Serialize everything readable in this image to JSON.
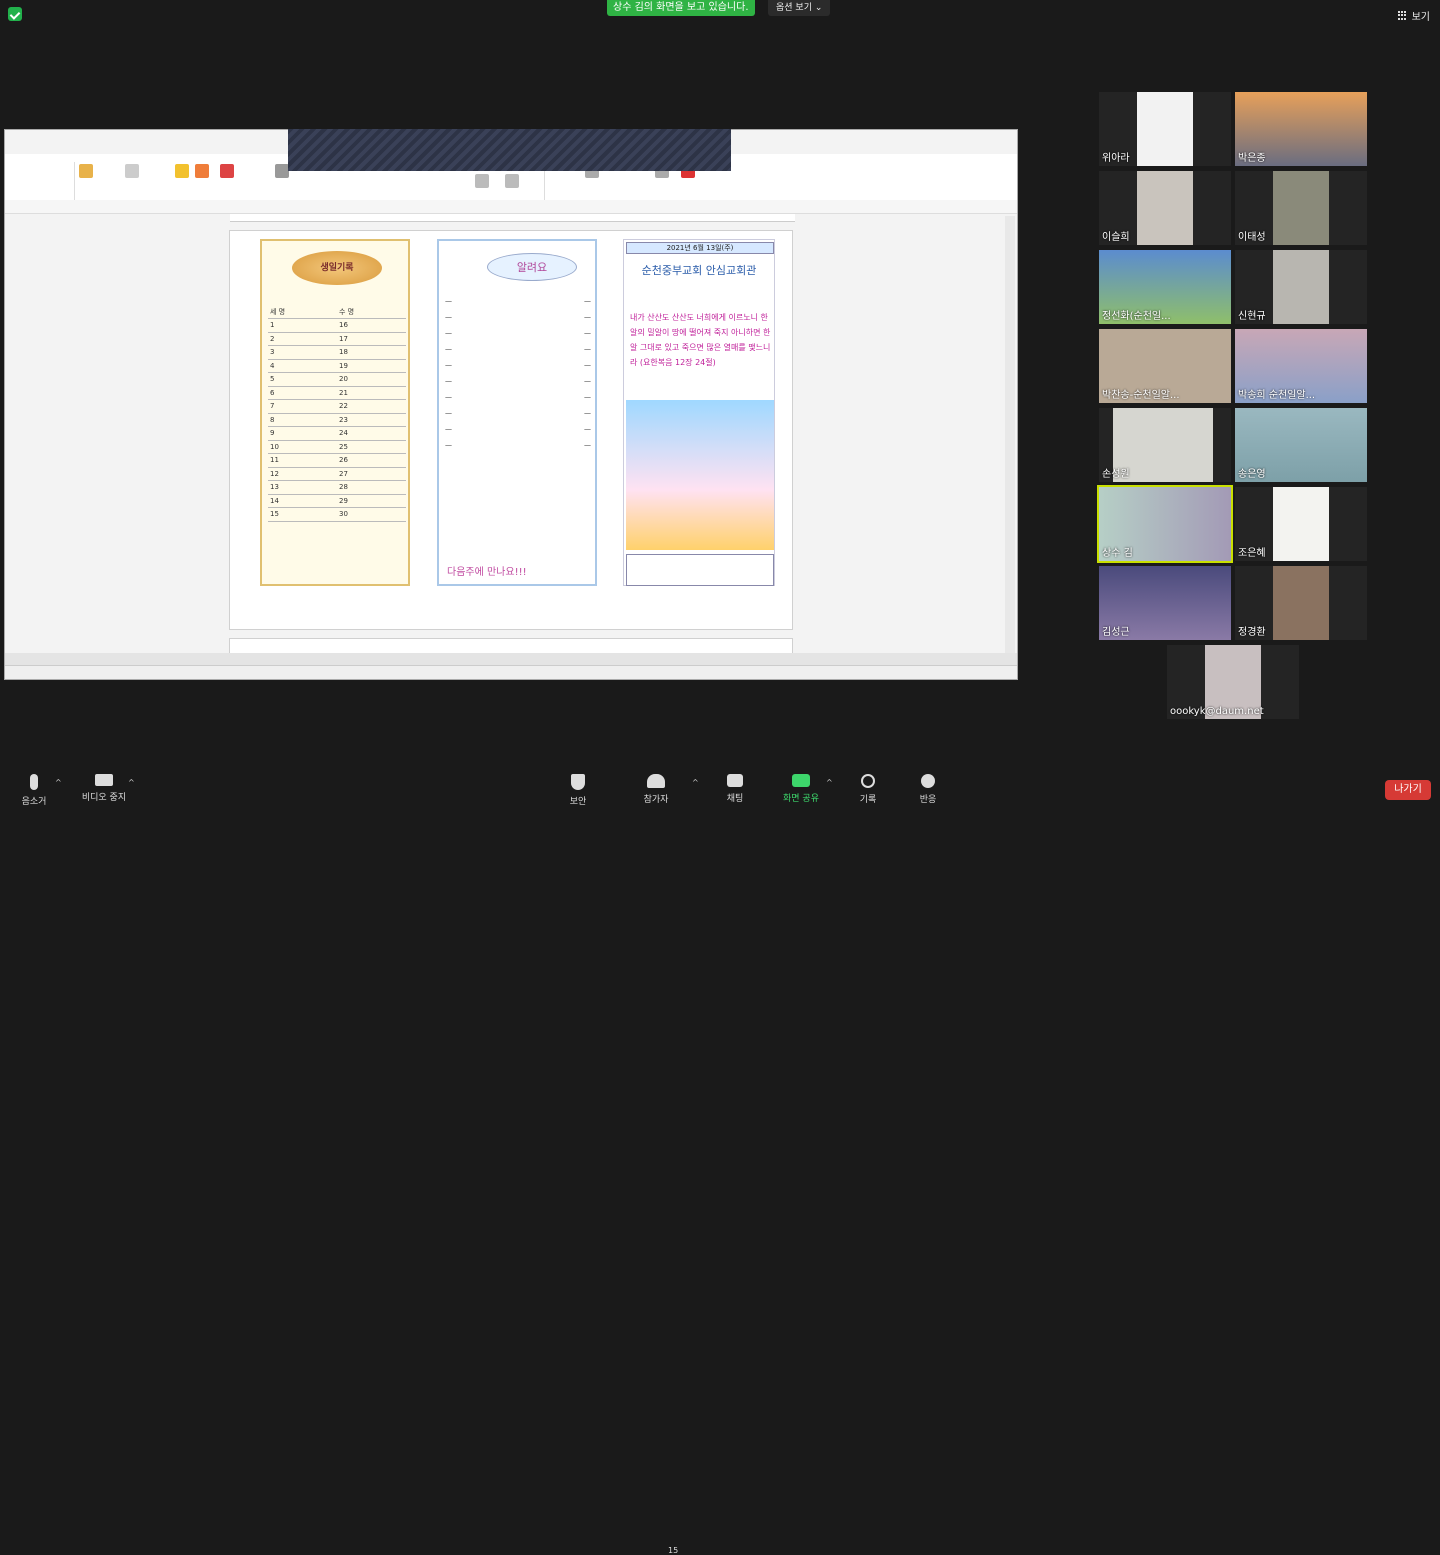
{
  "top": {
    "share_banner": "상수 김의 화면을 보고 있습니다.",
    "view_options": "옵션 보기 ⌄",
    "view_label": "보기"
  },
  "shared_doc": {
    "left_bread": "생일기록",
    "left_table": {
      "headers": [
        "세 명",
        "수 명"
      ],
      "rows": [
        "16",
        "17",
        "18",
        "19",
        "20",
        "21",
        "22",
        "23",
        "24",
        "25",
        "26",
        "27",
        "28",
        "29",
        "30"
      ]
    },
    "middle_title": "알려요",
    "middle_footer": "다음주에 만나요!!!",
    "right_date": "2021년 6월 13일(주)",
    "right_church": "순천중부교회 안심교회관",
    "right_verse": "내가 산산도 산산도 너희에게 이르노니 한 알의 밀알이 땅에 떨어져 죽지 아니하면 한 알 그대로 있고 죽으면 많은 열매를 맺느니라 (요한복음 12장 24절)"
  },
  "participants": [
    {
      "name": "위아라",
      "bg": "#f2f2f2"
    },
    {
      "name": "박은종",
      "bg": "#d68a45"
    },
    {
      "name": "이슬희",
      "bg": "#c9c4bd"
    },
    {
      "name": "이태성",
      "bg": "#8a8a7a"
    },
    {
      "name": "정선화(순천일...",
      "bg": "#5b8ccf"
    },
    {
      "name": "신현규",
      "bg": "#b8b6b0"
    },
    {
      "name": "박찬송-순천일알...",
      "bg": "#b9a996"
    },
    {
      "name": "박송희 순천일알...",
      "bg": "#c8a7b6"
    },
    {
      "name": "손성원",
      "bg": "#d6d6d0"
    },
    {
      "name": "송은영",
      "bg": "#7da0a8"
    },
    {
      "name": "상수 김",
      "bg": "#b6cfc6"
    },
    {
      "name": "조은혜",
      "bg": "#f3f3f0"
    },
    {
      "name": "김성근",
      "bg": "#4a4a7c"
    },
    {
      "name": "정경환",
      "bg": "#8a7260"
    },
    {
      "name": "oookyk@daum.net",
      "bg": "#c8bfc0"
    }
  ],
  "toolbar": {
    "mute": "음소거",
    "video": "비디오 중지",
    "security": "보안",
    "participants": "참가자",
    "participants_count": "15",
    "chat": "채팅",
    "share": "화면 공유",
    "record": "기록",
    "reactions": "반응",
    "leave": "나가기"
  }
}
